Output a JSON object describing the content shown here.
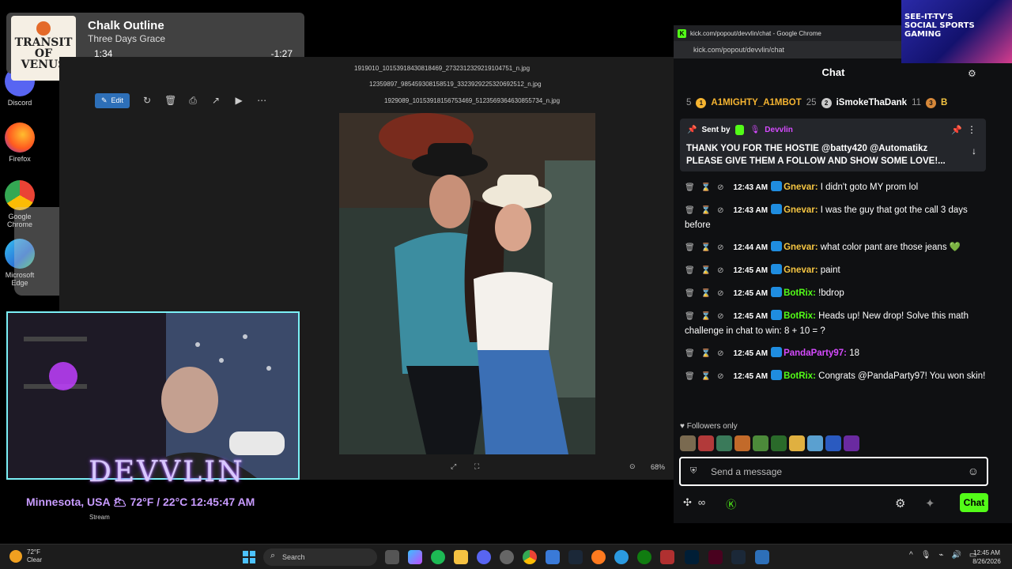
{
  "desktop": {
    "icons": [
      {
        "label": "Discord"
      },
      {
        "label": "Firefox"
      },
      {
        "label": "Google Chrome"
      },
      {
        "label": "Microsoft Edge"
      }
    ]
  },
  "media": {
    "art_text": "TRANSIT OF VENUS",
    "title": "Chalk Outline",
    "artist": "Three Days Grace",
    "position": "1:34",
    "remaining": "-1:27",
    "progress": 0.52
  },
  "viewer": {
    "files": [
      "1919010_10153918430818469_2732312329219104751_n.jpg",
      "12359897_985459308158519_3323929225320692512_n.jpg",
      "1929089_10153918156753469_5123569364630855734_n.jpg"
    ],
    "edit_label": "Edit",
    "zoom": "68%"
  },
  "chrome": {
    "window_title": "kick.com/popout/devvlin/chat - Google Chrome",
    "url": "kick.com/popout/devvlin/chat",
    "chat_title": "Chat",
    "leaders": {
      "prev_num": "5",
      "first": {
        "rank": "1",
        "name": "A1MIGHTY_A1MBOT",
        "count": "25"
      },
      "second": {
        "rank": "2",
        "name": "iSmokeThaDank",
        "count": "11"
      },
      "third": {
        "rank": "3",
        "name": "B"
      }
    },
    "pinned": {
      "sent_by": "Sent by",
      "user": "Devvlin",
      "line1": "THANK YOU FOR THE HOSTIE @batty420 @Automatikz",
      "line2": "PLEASE GIVE THEM A FOLLOW AND SHOW SOME LOVE!..."
    },
    "messages": [
      {
        "time": "12:43 AM",
        "user": "Gnevar:",
        "color": "#f5c542",
        "text": "I didn't goto MY prom lol"
      },
      {
        "time": "12:43 AM",
        "user": "Gnevar:",
        "color": "#f5c542",
        "text": "I was the guy that got the call 3 days before"
      },
      {
        "time": "12:44 AM",
        "user": "Gnevar:",
        "color": "#f5c542",
        "text": "what color pant are those jeans 💚"
      },
      {
        "time": "12:45 AM",
        "user": "Gnevar:",
        "color": "#f5c542",
        "text": "paint"
      },
      {
        "time": "12:45 AM",
        "user": "BotRix:",
        "color": "#53fc18",
        "text": "!bdrop"
      },
      {
        "time": "12:45 AM",
        "user": "BotRix:",
        "color": "#53fc18",
        "text": "Heads up! New drop! Solve this math challenge in chat to win: 8 + 10 = ?"
      },
      {
        "time": "12:45 AM",
        "user": "PandaParty97:",
        "color": "#d64bff",
        "text": "18"
      },
      {
        "time": "12:45 AM",
        "user": "BotRix:",
        "color": "#53fc18",
        "text": "Congrats @PandaParty97! You won skin!"
      }
    ],
    "followers_only": "Followers only",
    "input_placeholder": "Send a message",
    "send_label": "Chat"
  },
  "ad": {
    "lines": [
      "SEE-IT-TV'S",
      "SOCIAL SPORTS",
      "GAMING"
    ]
  },
  "stream": {
    "brand": "DEVVLIN",
    "weather": "Minnesota, USA 🌥 72°F / 22°C 12:45:47 AM",
    "stream_label": "Stream"
  },
  "taskbar": {
    "temp": "72°F",
    "condition": "Clear",
    "search_placeholder": "Search",
    "time": "12:45 AM",
    "date": "8/26/2026"
  },
  "colors": {
    "kick_green": "#53fc18",
    "accent_blue": "#2d6fb8"
  }
}
